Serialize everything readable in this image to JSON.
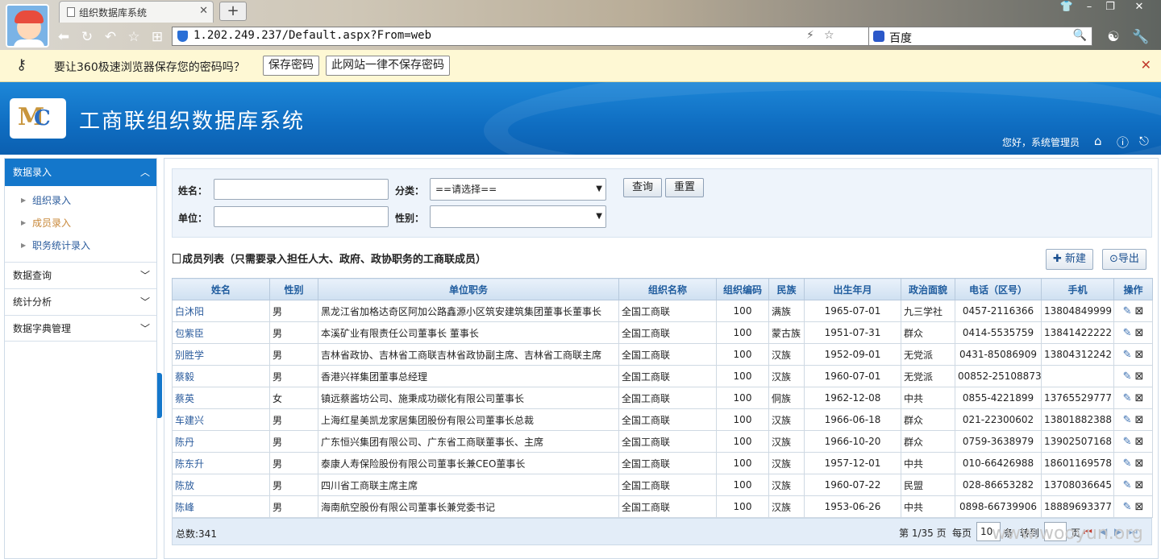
{
  "browser": {
    "tab_title": "组织数据库系统",
    "url": "1.202.249.237/Default.aspx?From=web",
    "search_engine": "百度"
  },
  "password_bar": {
    "message": "要让360极速浏览器保存您的密码吗？",
    "save_label": "保存密码",
    "never_label": "此网站一律不保存密码"
  },
  "app": {
    "title": "工商联组织数据库系统",
    "greeting": "您好，系统管理员"
  },
  "sidebar": {
    "active_group": "数据录入",
    "sub_items": [
      "组织录入",
      "成员录入",
      "职务统计录入"
    ],
    "current_sub": "成员录入",
    "groups": [
      "数据查询",
      "统计分析",
      "数据字典管理"
    ]
  },
  "search": {
    "name_label": "姓名：",
    "category_label": "分类：",
    "category_value": "==请选择==",
    "unit_label": "单位：",
    "gender_label": "性别：",
    "gender_value": "",
    "query_label": "查询",
    "reset_label": "重置"
  },
  "list": {
    "title": "成员列表（只需要录入担任人大、政府、政协职务的工商联成员）",
    "new_label": "新建",
    "export_label": "导出",
    "columns": [
      "姓名",
      "性别",
      "单位职务",
      "组织名称",
      "组织编码",
      "民族",
      "出生年月",
      "政治面貌",
      "电话（区号）",
      "手机",
      "操作"
    ],
    "rows": [
      [
        "白沐阳",
        "男",
        "黑龙江省加格达奇区阿加公路鑫源小区筑安建筑集团董事长董事长",
        "全国工商联",
        "100",
        "满族",
        "1965-07-01",
        "九三学社",
        "0457-2116366",
        "13804849999"
      ],
      [
        "包紫臣",
        "男",
        "本溪矿业有限责任公司董事长 董事长",
        "全国工商联",
        "100",
        "蒙古族",
        "1951-07-31",
        "群众",
        "0414-5535759",
        "13841422222"
      ],
      [
        "别胜学",
        "男",
        "吉林省政协、吉林省工商联吉林省政协副主席、吉林省工商联主席",
        "全国工商联",
        "100",
        "汉族",
        "1952-09-01",
        "无党派",
        "0431-85086909",
        "13804312242"
      ],
      [
        "蔡毅",
        "男",
        "香港兴祥集团董事总经理",
        "全国工商联",
        "100",
        "汉族",
        "1960-07-01",
        "无党派",
        "00852-25108873",
        ""
      ],
      [
        "蔡英",
        "女",
        "镇远蔡酱坊公司、施秉成功碳化有限公司董事长",
        "全国工商联",
        "100",
        "侗族",
        "1962-12-08",
        "中共",
        "0855-4221899",
        "13765529777"
      ],
      [
        "车建兴",
        "男",
        "上海红星美凯龙家居集团股份有限公司董事长总裁",
        "全国工商联",
        "100",
        "汉族",
        "1966-06-18",
        "群众",
        "021-22300602",
        "13801882388"
      ],
      [
        "陈丹",
        "男",
        "广东恒兴集团有限公司、广东省工商联董事长、主席",
        "全国工商联",
        "100",
        "汉族",
        "1966-10-20",
        "群众",
        "0759-3638979",
        "13902507168"
      ],
      [
        "陈东升",
        "男",
        "泰康人寿保险股份有限公司董事长兼CEO董事长",
        "全国工商联",
        "100",
        "汉族",
        "1957-12-01",
        "中共",
        "010-66426988",
        "18601169578"
      ],
      [
        "陈放",
        "男",
        "四川省工商联主席主席",
        "全国工商联",
        "100",
        "汉族",
        "1960-07-22",
        "民盟",
        "028-86653282",
        "13708036645"
      ],
      [
        "陈峰",
        "男",
        "海南航空股份有限公司董事长兼党委书记",
        "全国工商联",
        "100",
        "汉族",
        "1953-06-26",
        "中共",
        "0898-66739906",
        "18889693377"
      ]
    ]
  },
  "footer": {
    "total": "总数:341",
    "page_info": "第 1/35 页",
    "per_page_label": "每页",
    "per_page_value": "10",
    "per_page_unit": "条",
    "goto_label": "转到",
    "goto_value": "",
    "page_unit": "页"
  },
  "watermark": "www.wooyun.org"
}
